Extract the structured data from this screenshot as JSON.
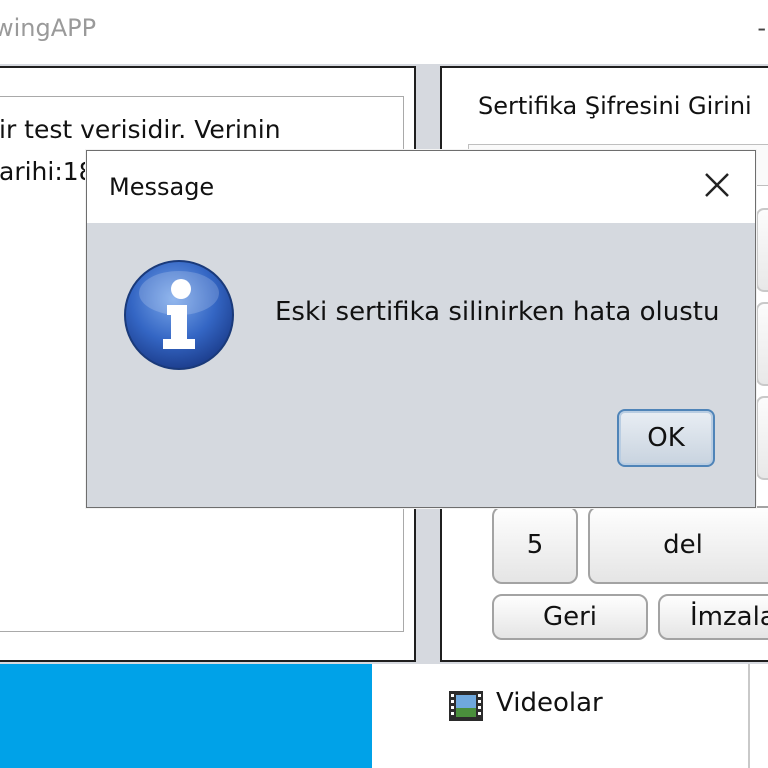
{
  "window": {
    "title": "wingAPP",
    "minimize": "-"
  },
  "left_panel": {
    "line1": "ir test verisidir. Verinin",
    "line2": "arihi:18"
  },
  "right_panel": {
    "cert_label": "Sertifika Şifresini Girini",
    "keys": {
      "five": "5",
      "del": "del"
    },
    "back_button": "Geri",
    "sign_button": "İmzala"
  },
  "explorer": {
    "videos_label": "Videolar",
    "videos_icon": "film-icon"
  },
  "dialog": {
    "title": "Message",
    "message": "Eski sertifika silinirken hata olustu",
    "ok_button": "OK",
    "icon": "info-icon"
  },
  "colors": {
    "accent_blue": "#00a2e8",
    "dialog_bg": "#d5d9df",
    "info_icon": "#2f5fb3"
  }
}
